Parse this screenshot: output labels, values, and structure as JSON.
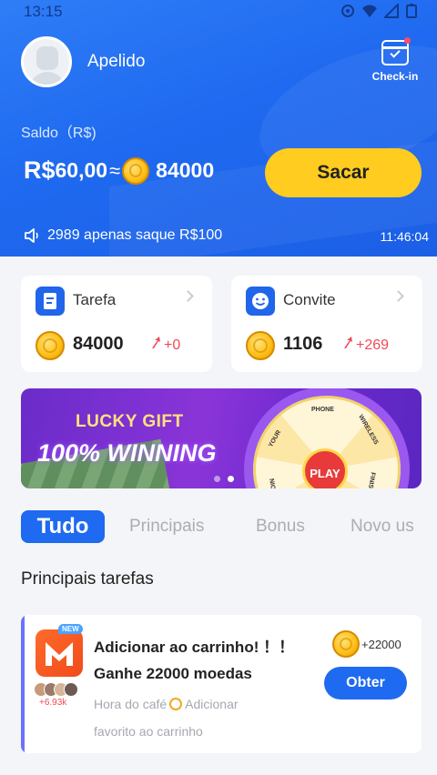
{
  "status_bar": {
    "time": "13:15"
  },
  "profile": {
    "nickname": "Apelido",
    "checkin_label": "Check-in"
  },
  "balance": {
    "label": "Saldo（R$)",
    "currency": "R$",
    "amount": "60,00",
    "approx": "≈",
    "coins": "84000",
    "withdraw_button": "Sacar"
  },
  "notice": {
    "text": "2989 apenas saque R$100",
    "time": "11:46:04"
  },
  "cards": [
    {
      "title": "Tarefa",
      "value": "84000",
      "delta": "+0",
      "icon": "task-icon"
    },
    {
      "title": "Convite",
      "value": "1106",
      "delta": "+269",
      "icon": "smile-icon"
    }
  ],
  "banner": {
    "title": "LUCKY GIFT",
    "subtitle": "100% WINNING",
    "wheel_center": "PLAY",
    "wheel_labels": [
      "PHONE",
      "WIRELESS",
      "FINISH",
      "YOUR",
      "COIN"
    ],
    "slide_count": 2,
    "active_slide": 2
  },
  "tabs": [
    "Tudo",
    "Principais",
    "Bonus",
    "Novo us"
  ],
  "active_tab": 0,
  "section_title": "Principais tarefas",
  "task": {
    "badge": "NEW",
    "title_line1": "Adicionar ao carrinho! ！！",
    "title_line2": "Ganhe 22000 moedas",
    "description_part1": "Hora do café",
    "description_part2": "Adicionar favorito ao carrinho",
    "users": "+6.93k",
    "reward": "+22000",
    "action_button": "Obter"
  },
  "colors": {
    "primary": "#1e6af0",
    "accent_yellow": "#ffcc1f",
    "positive_red": "#f04a56",
    "banner_purple": "#7b30d4"
  }
}
